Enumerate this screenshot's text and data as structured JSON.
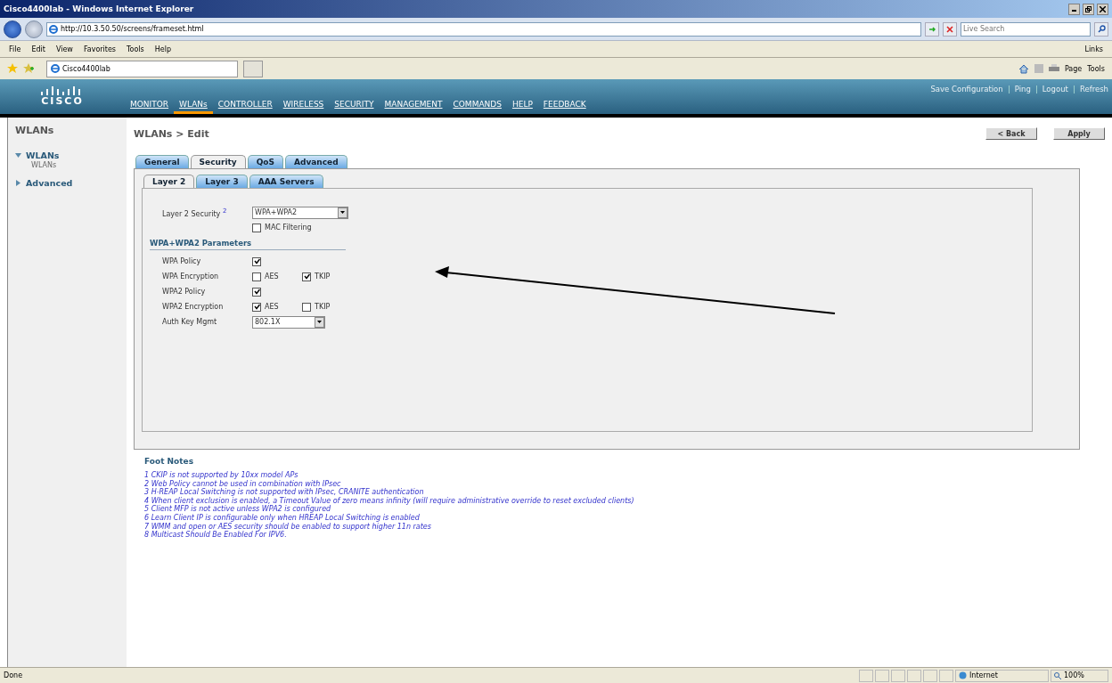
{
  "window": {
    "title": "Cisco4400lab - Windows Internet Explorer"
  },
  "address_bar": {
    "url": "http://10.3.50.50/screens/frameset.html"
  },
  "search": {
    "placeholder": "Live Search"
  },
  "menu": [
    "File",
    "Edit",
    "View",
    "Favorites",
    "Tools",
    "Help"
  ],
  "links_label": "Links",
  "browser_tab": {
    "title": "Cisco4400lab"
  },
  "command_bar": [
    "Page",
    "Tools"
  ],
  "header": {
    "logo_text": "CISCO",
    "nav": [
      {
        "label": "MONITOR",
        "selected": false
      },
      {
        "label": "WLANs",
        "selected": true
      },
      {
        "label": "CONTROLLER",
        "selected": false
      },
      {
        "label": "WIRELESS",
        "selected": false
      },
      {
        "label": "SECURITY",
        "selected": false
      },
      {
        "label": "MANAGEMENT",
        "selected": false
      },
      {
        "label": "COMMANDS",
        "selected": false
      },
      {
        "label": "HELP",
        "selected": false
      },
      {
        "label": "FEEDBACK",
        "selected": false
      }
    ],
    "links": [
      "Save Configuration",
      "Ping",
      "Logout",
      "Refresh"
    ]
  },
  "sidebar": {
    "title": "WLANs",
    "items": [
      {
        "label": "WLANs",
        "expanded": true,
        "children": [
          {
            "label": "WLANs"
          }
        ]
      },
      {
        "label": "Advanced",
        "expanded": false
      }
    ]
  },
  "page": {
    "title": "WLANs > Edit",
    "buttons": [
      "< Back",
      "Apply"
    ]
  },
  "tabs": [
    {
      "label": "General",
      "selected": false
    },
    {
      "label": "Security",
      "selected": true
    },
    {
      "label": "QoS",
      "selected": false
    },
    {
      "label": "Advanced",
      "selected": false
    }
  ],
  "subtabs": [
    {
      "label": "Layer 2",
      "selected": true
    },
    {
      "label": "Layer 3",
      "selected": false
    },
    {
      "label": "AAA Servers",
      "selected": false
    }
  ],
  "layer2_security": {
    "label": "Layer 2 Security",
    "footnote": "2",
    "value": "WPA+WPA2"
  },
  "mac_filtering": {
    "label": "MAC Filtering",
    "checked": false
  },
  "parameters": {
    "title": "WPA+WPA2 Parameters",
    "rows": [
      {
        "kind": "checkbox",
        "label": "WPA Policy",
        "checked": true
      },
      {
        "kind": "pair",
        "label": "WPA Encryption",
        "options": [
          {
            "label": "AES",
            "checked": false
          },
          {
            "label": "TKIP",
            "checked": true
          }
        ]
      },
      {
        "kind": "checkbox",
        "label": "WPA2 Policy",
        "checked": true
      },
      {
        "kind": "pair",
        "label": "WPA2 Encryption",
        "options": [
          {
            "label": "AES",
            "checked": true
          },
          {
            "label": "TKIP",
            "checked": false
          }
        ]
      },
      {
        "kind": "select",
        "label": "Auth Key Mgmt",
        "value": "802.1X"
      }
    ]
  },
  "footnotes": {
    "title": "Foot Notes",
    "items": [
      "1 CKIP is not supported by 10xx model APs",
      "2 Web Policy cannot be used in combination with IPsec",
      "3 H-REAP Local Switching is not supported with IPsec, CRANITE authentication",
      "4 When client exclusion is enabled, a Timeout Value of zero means infinity (will require administrative override to reset excluded clients)",
      "5 Client MFP is not active unless WPA2 is configured",
      "6 Learn Client IP is configurable only when HREAP Local Switching is enabled",
      "7 WMM and open or AES security should be enabled to support higher 11n rates",
      "8 Multicast Should Be Enabled For IPV6."
    ]
  },
  "status_bar": {
    "text": "Done",
    "zone": "Internet",
    "zoom": "100%"
  }
}
